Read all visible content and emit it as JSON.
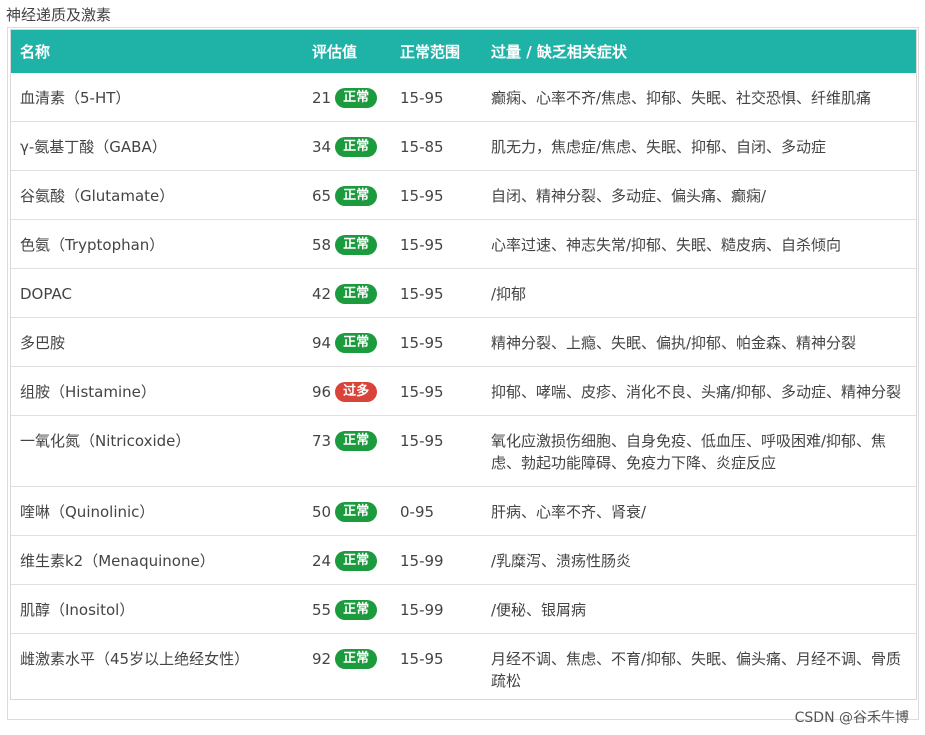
{
  "title": "神经递质及激素",
  "headers": {
    "name": "名称",
    "value": "评估值",
    "range": "正常范围",
    "symptoms": "过量 / 缺乏相关症状"
  },
  "rows": [
    {
      "name": "血清素（5-HT）",
      "value": "21",
      "status": "正常",
      "status_type": "normal",
      "range": "15-95",
      "symptoms": "癫痫、心率不齐/焦虑、抑郁、失眠、社交恐惧、纤维肌痛"
    },
    {
      "name": "γ-氨基丁酸（GABA）",
      "value": "34",
      "status": "正常",
      "status_type": "normal",
      "range": "15-85",
      "symptoms": "肌无力，焦虑症/焦虑、失眠、抑郁、自闭、多动症"
    },
    {
      "name": "谷氨酸（Glutamate）",
      "value": "65",
      "status": "正常",
      "status_type": "normal",
      "range": "15-95",
      "symptoms": "自闭、精神分裂、多动症、偏头痛、癫痫/"
    },
    {
      "name": "色氨（Tryptophan）",
      "value": "58",
      "status": "正常",
      "status_type": "normal",
      "range": "15-95",
      "symptoms": "心率过速、神志失常/抑郁、失眠、糙皮病、自杀倾向"
    },
    {
      "name": "DOPAC",
      "value": "42",
      "status": "正常",
      "status_type": "normal",
      "range": "15-95",
      "symptoms": "/抑郁"
    },
    {
      "name": "多巴胺",
      "value": "94",
      "status": "正常",
      "status_type": "normal",
      "range": "15-95",
      "symptoms": "精神分裂、上瘾、失眠、偏执/抑郁、帕金森、精神分裂"
    },
    {
      "name": "组胺（Histamine）",
      "value": "96",
      "status": "过多",
      "status_type": "high",
      "range": "15-95",
      "symptoms": "抑郁、哮喘、皮疹、消化不良、头痛/抑郁、多动症、精神分裂"
    },
    {
      "name": "一氧化氮（Nitricoxide）",
      "value": "73",
      "status": "正常",
      "status_type": "normal",
      "range": "15-95",
      "symptoms": "氧化应激损伤细胞、自身免疫、低血压、呼吸困难/抑郁、焦虑、勃起功能障碍、免疫力下降、炎症反应"
    },
    {
      "name": "喹啉（Quinolinic）",
      "value": "50",
      "status": "正常",
      "status_type": "normal",
      "range": "0-95",
      "symptoms": "肝病、心率不齐、肾衰/"
    },
    {
      "name": "维生素k2（Menaquinone）",
      "value": "24",
      "status": "正常",
      "status_type": "normal",
      "range": "15-99",
      "symptoms": "/乳糜泻、溃疡性肠炎"
    },
    {
      "name": "肌醇（Inositol）",
      "value": "55",
      "status": "正常",
      "status_type": "normal",
      "range": "15-99",
      "symptoms": "/便秘、银屑病"
    },
    {
      "name": "雌激素水平（45岁以上绝经女性）",
      "value": "92",
      "status": "正常",
      "status_type": "normal",
      "range": "15-95",
      "symptoms": "月经不调、焦虑、不育/抑郁、失眠、偏头痛、月经不调、骨质疏松"
    }
  ],
  "watermark": "CSDN @谷禾牛博"
}
